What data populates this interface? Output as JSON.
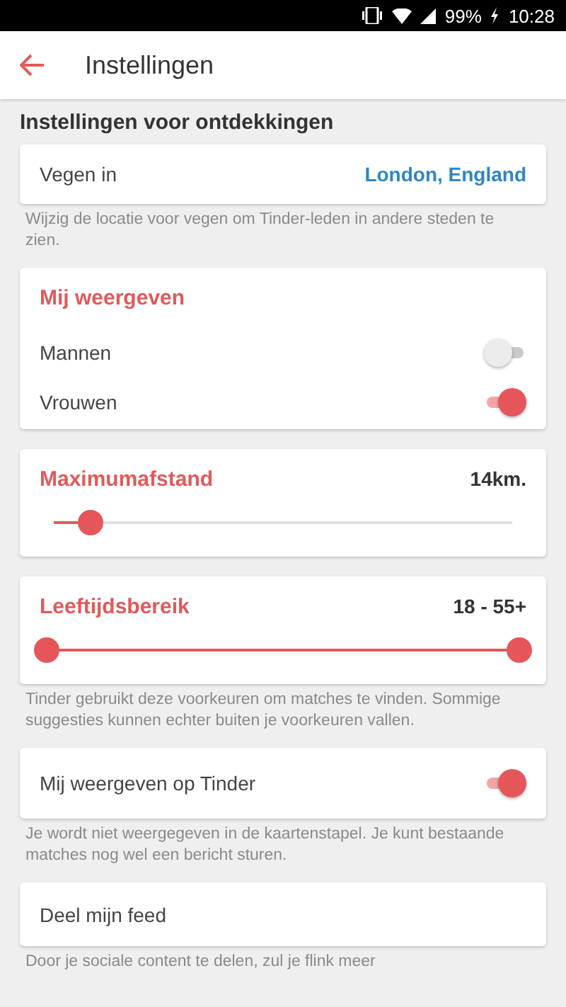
{
  "status_bar": {
    "battery": "99%",
    "time": "10:28"
  },
  "header": {
    "title": "Instellingen"
  },
  "section_title": "Instellingen voor ontdekkingen",
  "location": {
    "label": "Vegen in",
    "value": "London, England",
    "help": "Wijzig de locatie voor vegen om Tinder-leden in andere steden te zien."
  },
  "show_me": {
    "title": "Mij weergeven",
    "options": [
      {
        "label": "Mannen",
        "on": false
      },
      {
        "label": "Vrouwen",
        "on": true
      }
    ]
  },
  "distance": {
    "title": "Maximumafstand",
    "reading": "14km.",
    "level": 0.08
  },
  "age": {
    "title": "Leeftijdsbereik",
    "reading": "18 - 55+",
    "help": "Tinder gebruikt deze voorkeuren om matches te vinden. Sommige suggesties kunnen echter buiten je voorkeuren vallen."
  },
  "visibility": {
    "label": "Mij weergeven op Tinder",
    "on": true,
    "help": "Je wordt niet weergegeven in de kaartenstapel. Je kunt bestaande matches nog wel een bericht sturen."
  },
  "feed": {
    "label": "Deel mijn feed",
    "help": "Door je sociale content te delen, zul je flink meer"
  }
}
